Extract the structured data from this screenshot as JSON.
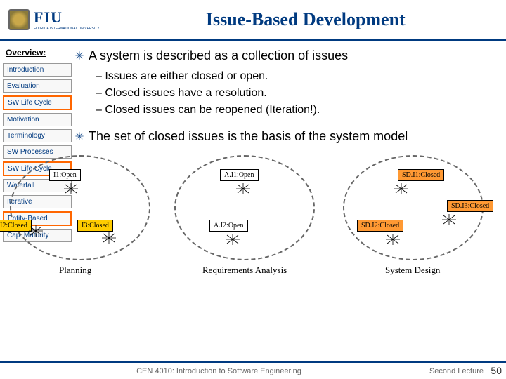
{
  "header": {
    "logo_text": "FIU",
    "logo_sub": "FLORIDA INTERNATIONAL UNIVERSITY",
    "title": "Issue-Based Development"
  },
  "sidebar": {
    "heading": "Overview:",
    "items": [
      {
        "label": "Introduction",
        "hl": false
      },
      {
        "label": "Evaluation",
        "hl": false
      },
      {
        "label": "SW Life Cycle",
        "hl": true
      },
      {
        "label": "Motivation",
        "hl": false
      },
      {
        "label": "Terminology",
        "hl": false
      },
      {
        "label": "SW Processes",
        "hl": false
      },
      {
        "label": "SW Life Cycle",
        "hl": true
      },
      {
        "label": "Waterfall",
        "hl": false
      },
      {
        "label": "Iterative",
        "hl": false
      },
      {
        "label": "Entity-Based",
        "hl": true
      },
      {
        "label": "Cap. Maturity",
        "hl": false
      }
    ]
  },
  "content": {
    "b1": "A system is described as a collection of issues",
    "s1": "Issues are either closed or open.",
    "s2": "Closed issues have a resolution.",
    "s3": "Closed issues can be reopened (Iteration!).",
    "b2": "The set of closed issues is the basis of the system model"
  },
  "diagram": {
    "tags": {
      "i1": "I1:Open",
      "i2": "I2:Closed",
      "i3": "I3:Closed",
      "ai1": "A.I1:Open",
      "ai2": "A.I2:Open",
      "sdi1": "SD.I1:Closed",
      "sdi2": "SD.I2:Closed",
      "sdi3": "SD.I3:Closed"
    },
    "labels": {
      "z1": "Planning",
      "z2": "Requirements Analysis",
      "z3": "System Design"
    }
  },
  "footer": {
    "left": "CEN 4010: Introduction to Software Engineering",
    "right": "Second Lecture",
    "page": "50"
  }
}
